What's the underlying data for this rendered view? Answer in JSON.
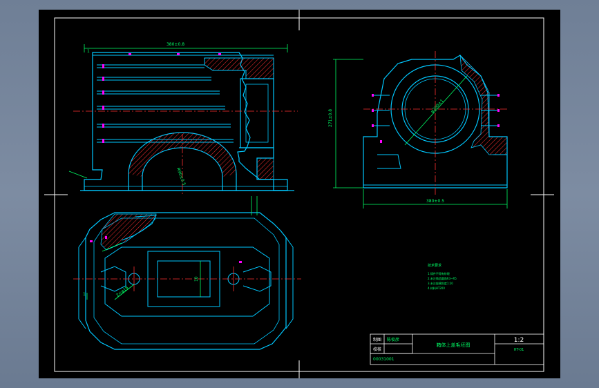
{
  "drawing": {
    "title": "箱体上盖毛坯图",
    "scale": "1:2",
    "sheet_code": "HT-01",
    "drawing_number": "00031001",
    "title_block": {
      "label_draw": "制图",
      "label_check": "校核",
      "name_draw": "陈俊彦"
    }
  },
  "dimensions": {
    "front_width": "380±0.8",
    "side_width": "380±0.5",
    "side_height": "271±0.8",
    "bore_diameter": "φ200±1",
    "arch_radius": "R90±0.5",
    "hole_dim": "2×φ18",
    "slot_width": "10",
    "left_marker": "1",
    "center_mark": "1"
  },
  "notes": {
    "heading": "技术要求",
    "lines": [
      "1.铸件不得有砂眼",
      "2.未注铸造圆角R3~R5",
      "3.未注拔模斜度1:20",
      "4.材料HT200"
    ]
  },
  "colors": {
    "outline": "#00c8ff",
    "center": "#ff3030",
    "dimension": "#00ff66",
    "hatch": "#ff3030",
    "border": "#ffffff",
    "accent": "#ff00ff"
  }
}
